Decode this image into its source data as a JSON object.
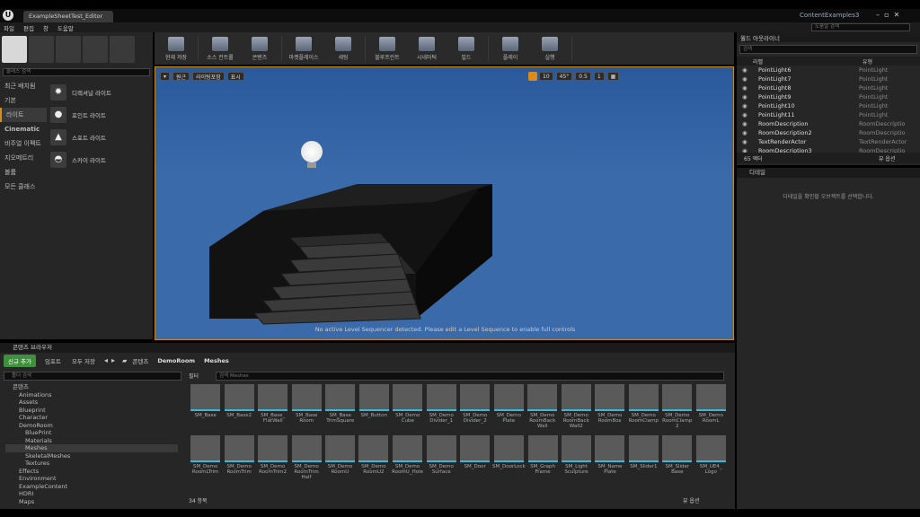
{
  "window": {
    "tab_title": "ExampleSheetTest_Editor",
    "app_name": "ContentExamples3",
    "search_placeholder": "도움말 검색"
  },
  "menu": [
    "파일",
    "편집",
    "창",
    "도움말"
  ],
  "modes": {
    "header": "모드",
    "search_placeholder": "클래스 검색",
    "categories": [
      "최근 배치됨",
      "기본",
      "라이트",
      "Cinematic",
      "비주얼 이펙트",
      "지오메트리",
      "볼륨",
      "모든 클래스"
    ],
    "items": [
      {
        "label": "디렉셔널 라이트",
        "icon": "✹"
      },
      {
        "label": "포인트 라이트",
        "icon": "●"
      },
      {
        "label": "스포트 라이트",
        "icon": "▲"
      },
      {
        "label": "스카이 라이트",
        "icon": "◓"
      }
    ]
  },
  "toolbar": [
    "현재 저장",
    "소스 컨트롤",
    "콘텐츠",
    "마켓플레이스",
    "세팅",
    "블루프린트",
    "시네마틱",
    "빌드",
    "플레이",
    "실행"
  ],
  "viewport": {
    "view_mode": "원근",
    "lighting": "라이팅포함",
    "show": "표시",
    "grid": "10",
    "angle": "45°",
    "scale": "0.5",
    "cam": "1",
    "message": "No active Level Sequencer detected. Please edit a Level Sequence to enable full controls"
  },
  "outliner": {
    "header": "월드 아웃라이너",
    "search_placeholder": "검색",
    "col_label": "라벨",
    "col_type": "유형",
    "rows": [
      {
        "label": "PointLight6",
        "type": "PointLight"
      },
      {
        "label": "PointLight7",
        "type": "PointLight"
      },
      {
        "label": "PointLight8",
        "type": "PointLight"
      },
      {
        "label": "PointLight9",
        "type": "PointLight"
      },
      {
        "label": "PointLight10",
        "type": "PointLight"
      },
      {
        "label": "PointLight11",
        "type": "PointLight"
      },
      {
        "label": "RoomDescription",
        "type": "RoomDescriptio"
      },
      {
        "label": "RoomDescription2",
        "type": "RoomDescriptio"
      },
      {
        "label": "TextRenderActor",
        "type": "TextRenderActor"
      },
      {
        "label": "RoomDescription3",
        "type": "RoomDescriptio"
      }
    ],
    "count": "65 액터",
    "view_options": "뷰 옵션"
  },
  "details": {
    "header": "디테일",
    "empty": "디테일을 확인할 오브젝트를 선택합니다."
  },
  "content_browser": {
    "header": "콘텐츠 브라우저",
    "add_new": "신규 추가",
    "import": "임포트",
    "save_all": "모두 저장",
    "path": [
      "콘텐츠",
      "DemoRoom",
      "Meshes"
    ],
    "search_placeholder": "폴더 검색",
    "filter": "필터",
    "asset_search_placeholder": "검색 Meshes",
    "count": "34 항목",
    "view_options": "뷰 옵션",
    "tree": [
      {
        "label": "콘텐츠",
        "d": 0
      },
      {
        "label": "Animations",
        "d": 1
      },
      {
        "label": "Assets",
        "d": 1
      },
      {
        "label": "Blueprint",
        "d": 1
      },
      {
        "label": "Character",
        "d": 1
      },
      {
        "label": "DemoRoom",
        "d": 1
      },
      {
        "label": "BluePrint",
        "d": 2
      },
      {
        "label": "Materials",
        "d": 2
      },
      {
        "label": "Meshes",
        "d": 2
      },
      {
        "label": "SkeletalMeshes",
        "d": 2
      },
      {
        "label": "Textures",
        "d": 2
      },
      {
        "label": "Effects",
        "d": 1
      },
      {
        "label": "Environment",
        "d": 1
      },
      {
        "label": "ExampleContent",
        "d": 1
      },
      {
        "label": "HDRI",
        "d": 1
      },
      {
        "label": "Maps",
        "d": 1
      }
    ],
    "assets_row1": [
      "SM_Base",
      "SM_Base2",
      "SM_Base_\nFlatWall",
      "SM_Base\nRoom",
      "SM_Base\nTrimSquare",
      "SM_Button",
      "SM_Demo\nCube",
      "SM_Demo\nDivider_1",
      "SM_Demo\nDivider_2",
      "SM_Demo\nPlate",
      "SM_Demo\nRoomBack\nWall",
      "SM_Demo\nRoomBack\nWall2",
      "SM_Demo\nRoomBox",
      "SM_Demo\nRoomClamp",
      "SM_Demo\nRoomClamp\n2",
      "SM_Demo\nRoomL"
    ],
    "assets_row2": [
      "SM_Demo\nRoomLTrim",
      "SM_Demo\nRoomTrim",
      "SM_Demo\nRoomTrim2",
      "SM_Demo\nRoomTrim\nHalf",
      "SM_Demo\nRoomU",
      "SM_Demo\nRoomU2",
      "SM_Demo\nRoomU_Hole",
      "SM_Demo\nSurface",
      "SM_Door",
      "SM_DoorLock",
      "SM_Graph\nFrame",
      "SM_Light\nSculpture",
      "SM_Name\nPlate",
      "SM_Slider1",
      "SM_Slider\nBase",
      "SM_UE4_\nLogo"
    ]
  }
}
